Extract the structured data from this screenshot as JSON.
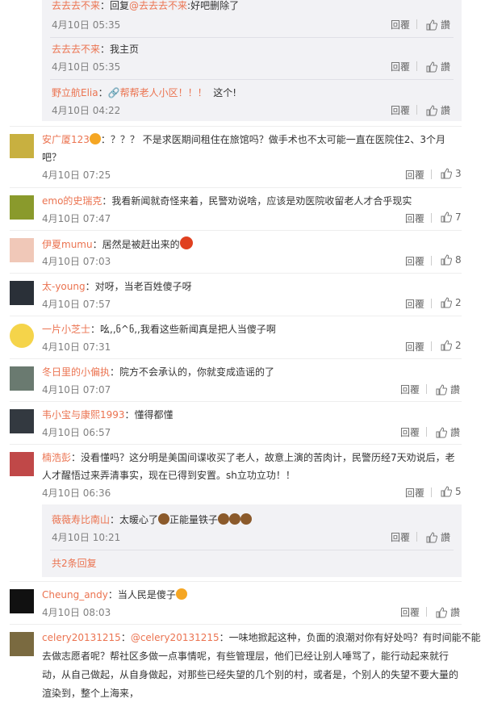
{
  "labels": {
    "reply": "回覆",
    "like": "讚"
  },
  "colors": {
    "name": "#eb7350",
    "meta": "#808080",
    "reply_bg": "#f2f2f5"
  },
  "top_subreplies": [
    {
      "name": "去去去不来",
      "text_prefix": "：回复",
      "mention": "@去去去不来",
      "text_suffix": ":好吧删除了",
      "time": "4月10日 05:35"
    },
    {
      "name": "去去去不来",
      "text": "：我主页",
      "time": "4月10日 05:35"
    },
    {
      "name": "野立航Elia",
      "text_prefix": "：",
      "link": "帮帮老人小区！！！",
      "text_suffix": "这个!",
      "time": "4月10日 04:22"
    }
  ],
  "comments": [
    {
      "name": "安广厦123",
      "text_1": "：？？？ 不是求医期间租住在旅馆吗？做手术也不太可能一直在医院住2、3个月",
      "text_2": "吧？",
      "time": "4月10日 07:25",
      "likes": "3"
    },
    {
      "name": "emo的史瑞克",
      "text": "：我看新闻就奇怪来着，民警劝说啥，应该是劝医院收留老人才合乎现实",
      "time": "4月10日 07:47",
      "likes": "7"
    },
    {
      "name": "伊夏mumu",
      "text": "：居然是被赶出来的",
      "time": "4月10日 07:03",
      "likes": "8"
    },
    {
      "name": "太-young",
      "text": "：对呀，当老百姓傻子呀",
      "time": "4月10日 07:57",
      "likes": "2"
    },
    {
      "name": "一片小芝士",
      "text": "：吆,,ნ^ნ,,我看这些新闻真是把人当傻子啊",
      "time": "4月10日 07:31",
      "likes": "2"
    },
    {
      "name": "冬日里的小偏执",
      "text": "：院方不会承认的，你就变成造谣的了",
      "time": "4月10日 07:07",
      "likes": ""
    },
    {
      "name": "韦小宝与康熙1993",
      "text": "：懂得都懂",
      "time": "4月10日 06:57",
      "likes": ""
    },
    {
      "name": "楠浩彭",
      "text_1": "：没看懂吗？这分明是美国间谍收买了老人，故意上演的苦肉计，民警历经7天劝说后，老",
      "text_2": "人才醒悟过来弄清事实，现在已得到安置。sh立功立功！！",
      "time": "4月10日 06:36",
      "likes": "5"
    },
    {
      "name": "Cheung_andy",
      "text": "：当人民是傻子",
      "time": "4月10日 08:03",
      "likes": ""
    }
  ],
  "nested_reply": {
    "name": "薇薇寿比南山",
    "text": "：太暖心了",
    "text_2": "正能量铁子",
    "time": "4月10日 10:21",
    "more": "共2条回复"
  },
  "last_comment": {
    "name": "celery20131215",
    "mention": "@celery20131215",
    "line_1": "：一味地掀起这种，负面的浪潮对你有好处吗？有时间能不能",
    "line_2": "去做志愿者呢？帮社区多做一点事情呢，有些管理层，他们已经让别人唾骂了，能行动起来就行",
    "line_3": "动，从自己做起，从自身做起，对那些已经失望的几个别的村，或者是，个别人的失望不要大量的",
    "line_4": "渲染到，整个上海来，"
  }
}
